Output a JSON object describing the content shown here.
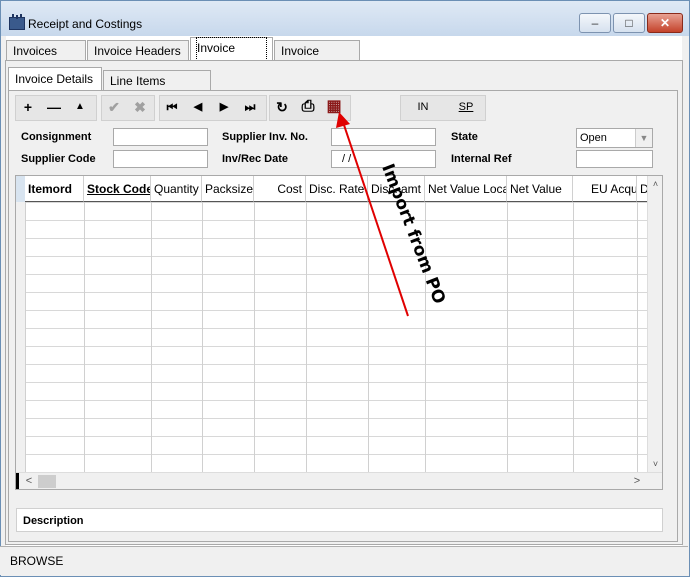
{
  "window": {
    "title": "Receipt and Costings",
    "min_glyph": "–",
    "max_glyph": "□",
    "close_glyph": "✕"
  },
  "main_tabs": [
    {
      "label": "Invoices List"
    },
    {
      "label": "Invoice Headers"
    },
    {
      "label": "Invoice Lines"
    },
    {
      "label": "Invoice Costs"
    }
  ],
  "sub_tabs": [
    {
      "label": "Invoice Details"
    },
    {
      "label": "Line Items Details"
    }
  ],
  "toolbar": {
    "add": "+",
    "remove": "—",
    "up": "▲",
    "ok": "✔",
    "cancel": "✖",
    "first": "⏮",
    "prev": "◀",
    "next": "▶",
    "last": "⏭",
    "refresh": "↻",
    "print": "⎙",
    "import": "▦",
    "in_label": "IN",
    "sp_label": "SP"
  },
  "form": {
    "consignment_label": "Consignment",
    "supplier_code_label": "Supplier Code",
    "supplier_inv_label": "Supplier Inv. No.",
    "inv_rec_date_label": "Inv/Rec Date",
    "inv_rec_date_value": "/  /",
    "state_label": "State",
    "state_value": "Open",
    "internal_ref_label": "Internal Ref"
  },
  "grid": {
    "columns": [
      "Itemord",
      "Stock Code",
      "Quantity",
      "Packsize",
      "Cost",
      "Disc. Rate",
      "Disc. amt",
      "Net Value Loca",
      "Net Value",
      "EU Acqui.",
      "D"
    ]
  },
  "description_label": "Description",
  "status": "BROWSE",
  "annotation": "Import from PO",
  "colors": {
    "arrow": "#e00000"
  }
}
